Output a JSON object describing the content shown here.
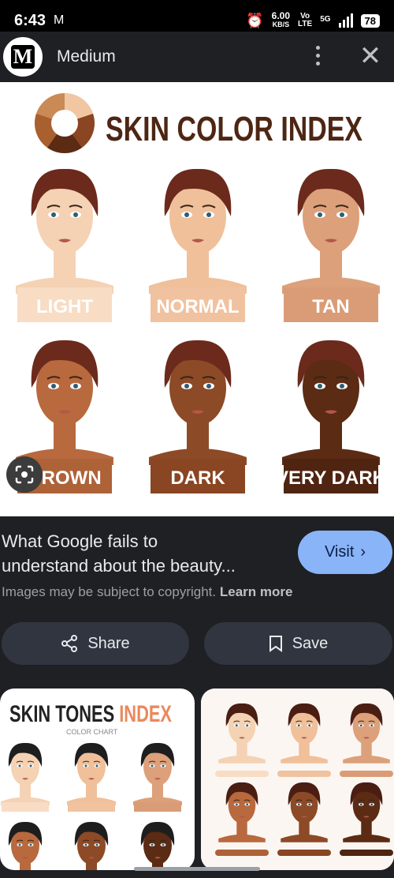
{
  "status": {
    "time": "6:43",
    "speed": "6.00",
    "speed_unit": "KB/S",
    "volte_top": "Vo",
    "volte_bottom": "LTE",
    "network": "5G",
    "battery": "78"
  },
  "app": {
    "logo": "M",
    "title": "Medium"
  },
  "hero": {
    "title": "SKIN COLOR INDEX",
    "tones": [
      {
        "label": "LIGHT",
        "skin": "#f4d2b3",
        "label_bg": "#f8dcc4"
      },
      {
        "label": "NORMAL",
        "skin": "#f0c09a",
        "label_bg": "#f1c29f"
      },
      {
        "label": "TAN",
        "skin": "#dca07a",
        "label_bg": "#d99c77"
      },
      {
        "label": "BROWN",
        "skin": "#b8693e",
        "label_bg": "#ae6238"
      },
      {
        "label": "DARK",
        "skin": "#8d4a26",
        "label_bg": "#8a4522"
      },
      {
        "label": "VERY DARK",
        "skin": "#5b2b14",
        "label_bg": "#4f2410"
      }
    ]
  },
  "result": {
    "title_line1": "What Google fails to",
    "title_line2": "understand about the beauty...",
    "visit": "Visit",
    "copyright": "Images may be subject to copyright.",
    "learn_more": "Learn more"
  },
  "actions": {
    "share": "Share",
    "save": "Save"
  },
  "related": {
    "thumb1_title_a": "SKIN TONES ",
    "thumb1_title_b": "INDEX",
    "thumb1_subtitle": "COLOR CHART"
  }
}
